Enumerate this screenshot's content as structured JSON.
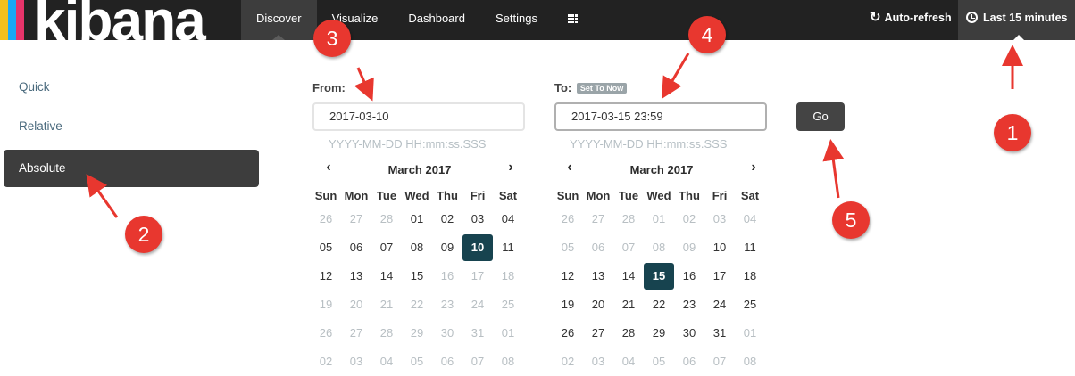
{
  "brand": {
    "name": "kibana",
    "bar_colors": [
      "#f3c01b",
      "#1ba9f5",
      "#e7346a",
      "#222222"
    ]
  },
  "nav": {
    "tabs": [
      {
        "label": "Discover",
        "active": true
      },
      {
        "label": "Visualize",
        "active": false
      },
      {
        "label": "Dashboard",
        "active": false
      },
      {
        "label": "Settings",
        "active": false
      }
    ],
    "apps_icon": "grid-icon"
  },
  "header": {
    "auto_refresh": "Auto-refresh",
    "time_label": "Last 15 minutes"
  },
  "sidebar": {
    "items": [
      {
        "label": "Quick",
        "active": false
      },
      {
        "label": "Relative",
        "active": false
      },
      {
        "label": "Absolute",
        "active": true
      }
    ]
  },
  "from": {
    "label": "From:",
    "value": "2017-03-10",
    "hint": "YYYY-MM-DD HH:mm:ss.SSS"
  },
  "to": {
    "label": "To:",
    "badge": "Set To Now",
    "value": "2017-03-15 23:59",
    "hint": "YYYY-MM-DD HH:mm:ss.SSS"
  },
  "go_label": "Go",
  "calendars": [
    {
      "title": "March 2017",
      "selected": "10",
      "weekdays": [
        "Sun",
        "Mon",
        "Tue",
        "Wed",
        "Thu",
        "Fri",
        "Sat"
      ],
      "weeks": [
        [
          [
            "26",
            1
          ],
          [
            "27",
            1
          ],
          [
            "28",
            1
          ],
          [
            "01",
            0
          ],
          [
            "02",
            0
          ],
          [
            "03",
            0
          ],
          [
            "04",
            0
          ]
        ],
        [
          [
            "05",
            0
          ],
          [
            "06",
            0
          ],
          [
            "07",
            0
          ],
          [
            "08",
            0
          ],
          [
            "09",
            0
          ],
          [
            "10",
            0
          ],
          [
            "11",
            0
          ]
        ],
        [
          [
            "12",
            0
          ],
          [
            "13",
            0
          ],
          [
            "14",
            0
          ],
          [
            "15",
            0
          ],
          [
            "16",
            1
          ],
          [
            "17",
            1
          ],
          [
            "18",
            1
          ]
        ],
        [
          [
            "19",
            1
          ],
          [
            "20",
            1
          ],
          [
            "21",
            1
          ],
          [
            "22",
            1
          ],
          [
            "23",
            1
          ],
          [
            "24",
            1
          ],
          [
            "25",
            1
          ]
        ],
        [
          [
            "26",
            1
          ],
          [
            "27",
            1
          ],
          [
            "28",
            1
          ],
          [
            "29",
            1
          ],
          [
            "30",
            1
          ],
          [
            "31",
            1
          ],
          [
            "01",
            1
          ]
        ],
        [
          [
            "02",
            1
          ],
          [
            "03",
            1
          ],
          [
            "04",
            1
          ],
          [
            "05",
            1
          ],
          [
            "06",
            1
          ],
          [
            "07",
            1
          ],
          [
            "08",
            1
          ]
        ]
      ]
    },
    {
      "title": "March 2017",
      "selected": "15",
      "weekdays": [
        "Sun",
        "Mon",
        "Tue",
        "Wed",
        "Thu",
        "Fri",
        "Sat"
      ],
      "weeks": [
        [
          [
            "26",
            1
          ],
          [
            "27",
            1
          ],
          [
            "28",
            1
          ],
          [
            "01",
            1
          ],
          [
            "02",
            1
          ],
          [
            "03",
            1
          ],
          [
            "04",
            1
          ]
        ],
        [
          [
            "05",
            1
          ],
          [
            "06",
            1
          ],
          [
            "07",
            1
          ],
          [
            "08",
            1
          ],
          [
            "09",
            1
          ],
          [
            "10",
            0
          ],
          [
            "11",
            0
          ]
        ],
        [
          [
            "12",
            0
          ],
          [
            "13",
            0
          ],
          [
            "14",
            0
          ],
          [
            "15",
            0
          ],
          [
            "16",
            0
          ],
          [
            "17",
            0
          ],
          [
            "18",
            0
          ]
        ],
        [
          [
            "19",
            0
          ],
          [
            "20",
            0
          ],
          [
            "21",
            0
          ],
          [
            "22",
            0
          ],
          [
            "23",
            0
          ],
          [
            "24",
            0
          ],
          [
            "25",
            0
          ]
        ],
        [
          [
            "26",
            0
          ],
          [
            "27",
            0
          ],
          [
            "28",
            0
          ],
          [
            "29",
            0
          ],
          [
            "30",
            0
          ],
          [
            "31",
            0
          ],
          [
            "01",
            1
          ]
        ],
        [
          [
            "02",
            1
          ],
          [
            "03",
            1
          ],
          [
            "04",
            1
          ],
          [
            "05",
            1
          ],
          [
            "06",
            1
          ],
          [
            "07",
            1
          ],
          [
            "08",
            1
          ]
        ]
      ]
    }
  ],
  "annotations": [
    "1",
    "2",
    "3",
    "4",
    "5"
  ],
  "annotation_color": "#e8372f",
  "selected_day_color": "#17434f"
}
